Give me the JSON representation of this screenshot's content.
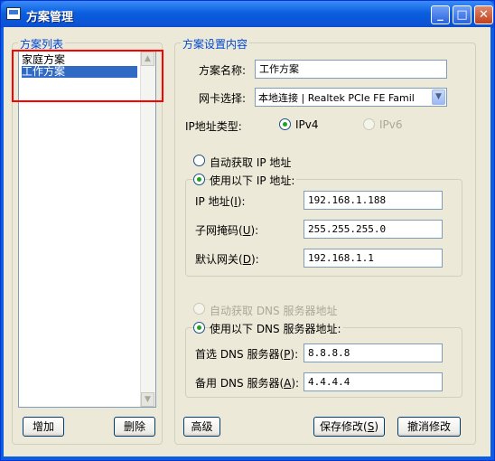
{
  "window": {
    "title": "方案管理",
    "min_symbol": "_",
    "max_symbol": "□",
    "close_symbol": "✕"
  },
  "list_section": {
    "title": "方案列表",
    "items": [
      {
        "label": "家庭方案",
        "selected": false
      },
      {
        "label": "工作方案",
        "selected": true
      }
    ],
    "add_label": "增加",
    "delete_label": "删除"
  },
  "settings": {
    "title": "方案设置内容",
    "name_label": "方案名称:",
    "name_value": "工作方案",
    "nic_label": "网卡选择:",
    "nic_value": "本地连接 | Realtek PCIe FE Famil",
    "ip_type_label": "IP地址类型:",
    "ipv4_label": "IPv4",
    "ipv6_label": "IPv6",
    "auto_ip_label": "自动获取 IP 地址",
    "manual_ip_label": "使用以下 IP 地址:",
    "ip_label_prefix": "IP  地址(",
    "ip_label_key": "I",
    "ip_label_suffix": "):",
    "ip_value": "192.168.1.188",
    "mask_label_prefix": "子网掩码(",
    "mask_label_key": "U",
    "mask_label_suffix": "):",
    "mask_value": "255.255.255.0",
    "gateway_label_prefix": "默认网关(",
    "gateway_label_key": "D",
    "gateway_label_suffix": "):",
    "gateway_value": "192.168.1.1",
    "auto_dns_label": "自动获取 DNS 服务器地址",
    "manual_dns_label": "使用以下 DNS 服务器地址:",
    "dns1_label_prefix": "首选 DNS 服务器(",
    "dns1_label_key": "P",
    "dns1_label_suffix": "):",
    "dns1_value": "8.8.8.8",
    "dns2_label_prefix": "备用 DNS 服务器(",
    "dns2_label_key": "A",
    "dns2_label_suffix": "):",
    "dns2_value": "4.4.4.4"
  },
  "buttons": {
    "advanced": "高级",
    "save_prefix": "保存修改(",
    "save_key": "S",
    "save_suffix": ")",
    "cancel": "撤消修改"
  }
}
